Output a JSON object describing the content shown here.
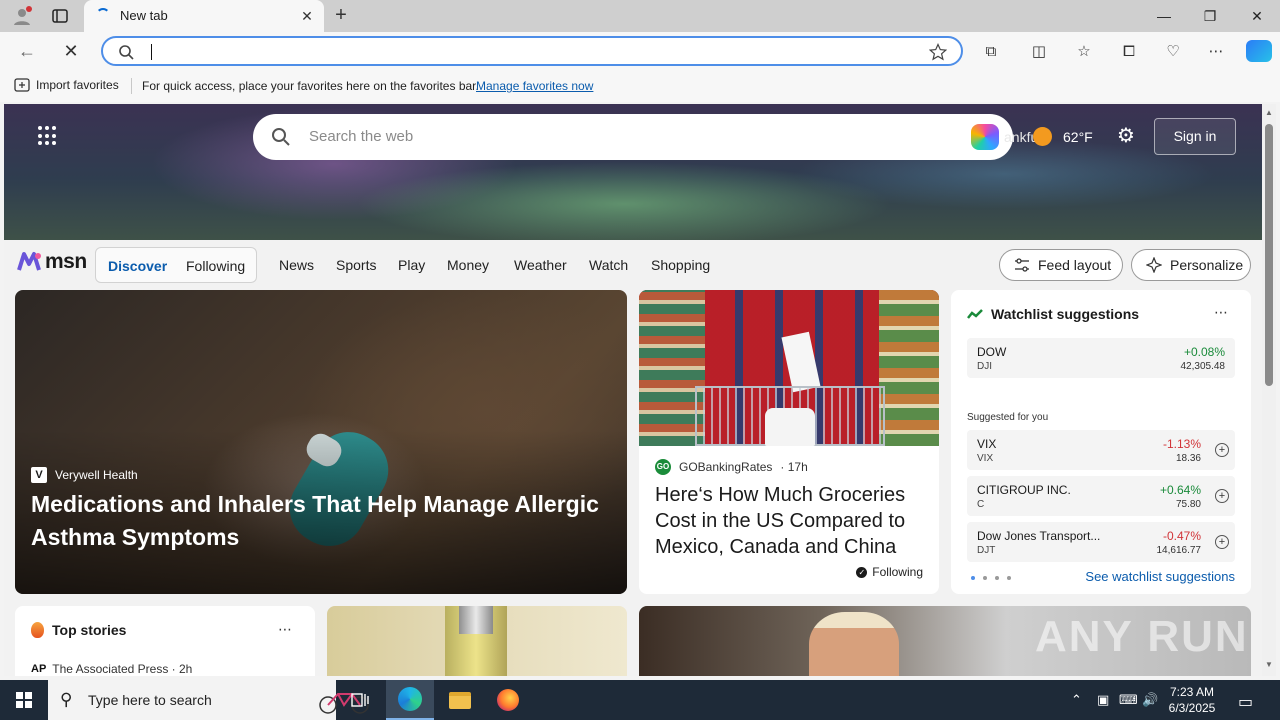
{
  "browser": {
    "tab_title": "New tab",
    "address_value": "",
    "favorites_bar": {
      "import_label": "Import favorites",
      "message": "For quick access, place your favorites here on the favorites bar.",
      "manage_link": "Manage favorites now"
    }
  },
  "hero": {
    "search_placeholder": "Search the web",
    "location": "ankfurt",
    "temperature": "62°F",
    "sign_in_label": "Sign in"
  },
  "msn_nav": {
    "logo_text": "msn",
    "segment_discover": "Discover",
    "segment_following": "Following",
    "links": [
      "News",
      "Sports",
      "Play",
      "Money",
      "Weather",
      "Watch",
      "Shopping"
    ],
    "feed_layout_label": "Feed layout",
    "personalize_label": "Personalize"
  },
  "main_card": {
    "source": "Verywell Health",
    "source_mark": "V",
    "title": "Medications and Inhalers That Help Manage Allergic Asthma Symptoms"
  },
  "mid_card": {
    "source": "GOBankingRates",
    "source_mark": "GO",
    "age": "· 17h",
    "title": "Here‘s How Much Groceries Cost in the US Compared to Mexico, Canada and China",
    "following_label": "Following"
  },
  "watchlist": {
    "title": "Watchlist suggestions",
    "main": {
      "name": "DOW",
      "symbol": "DJI",
      "change": "+0.08%",
      "value": "42,305.48",
      "direction": "up"
    },
    "suggested_label": "Suggested for you",
    "items": [
      {
        "name": "VIX",
        "symbol": "VIX",
        "change": "-1.13%",
        "value": "18.36",
        "direction": "down"
      },
      {
        "name": "CITIGROUP INC.",
        "symbol": "C",
        "change": "+0.64%",
        "value": "75.80",
        "direction": "up"
      },
      {
        "name": "Dow Jones Transport...",
        "symbol": "DJT",
        "change": "-0.47%",
        "value": "14,616.77",
        "direction": "down"
      }
    ],
    "see_link": "See watchlist suggestions"
  },
  "top_stories": {
    "title": "Top stories",
    "source_mark": "AP",
    "source": "The Associated Press · 2h"
  },
  "watermark": "ANY RUN",
  "taskbar": {
    "search_placeholder": "Type here to search",
    "time": "7:23 AM",
    "date": "6/3/2025"
  },
  "colors": {
    "accent": "#0b5cad",
    "positive": "#1a8a3a",
    "negative": "#d13438",
    "taskbar": "#1e2a38"
  }
}
